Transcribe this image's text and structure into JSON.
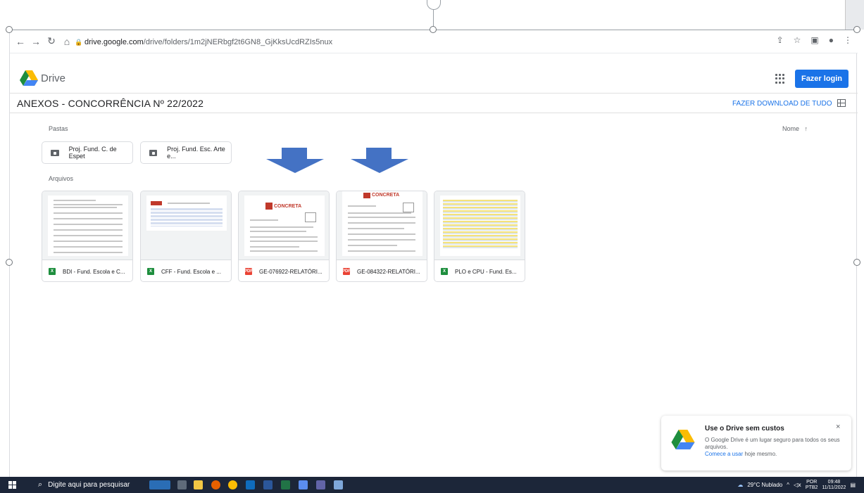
{
  "browser": {
    "url_host": "drive.google.com",
    "url_path": "/drive/folders/1m2jNERbgf2t6GN8_GjKksUcdRZIs5nux"
  },
  "drive": {
    "brand": "Drive",
    "login_label": "Fazer login",
    "folder_title": "ANEXOS - CONCORRÊNCIA Nº 22/2022",
    "download_all_label": "FAZER DOWNLOAD DE TUDO",
    "folders_label": "Pastas",
    "files_label": "Arquivos",
    "sort_label": "Nome",
    "sort_arrow": "↑",
    "folders": [
      {
        "name": "Proj. Fund. C. de Espet"
      },
      {
        "name": "Proj. Fund. Esc. Arte e..."
      }
    ],
    "files": [
      {
        "name": "BDI - Fund. Escola e C...",
        "type": "X",
        "kind": "sheet"
      },
      {
        "name": "CFF - Fund. Escola e ...",
        "type": "X",
        "kind": "sheet"
      },
      {
        "name": "GE-076922-RELATÓRI...",
        "type": "PDF",
        "kind": "pdf"
      },
      {
        "name": "GE-084322-RELATÓRI...",
        "type": "PDF",
        "kind": "pdf"
      },
      {
        "name": "PLO e CPU - Fund. Es...",
        "type": "X",
        "kind": "sheet"
      }
    ],
    "thumb_brand": "CONCRETA"
  },
  "toast": {
    "title": "Use o Drive sem custos",
    "text": "O Google Drive é um lugar seguro para todos os seus arquivos.",
    "link": "Comece a usar",
    "link_suffix": " hoje mesmo.",
    "close": "×"
  },
  "taskbar": {
    "search_placeholder": "Digite aqui para pesquisar",
    "weather": "29°C  Nublado",
    "lang_top": "POR",
    "lang_bottom": "PTB2",
    "time": "09:48",
    "date": "11/11/2022"
  },
  "colors": {
    "accent": "#1a73e8",
    "arrow": "#4472c4",
    "sheet": "#1e8e3e",
    "pdf": "#ea4335",
    "taskbar": "#1c2639"
  }
}
